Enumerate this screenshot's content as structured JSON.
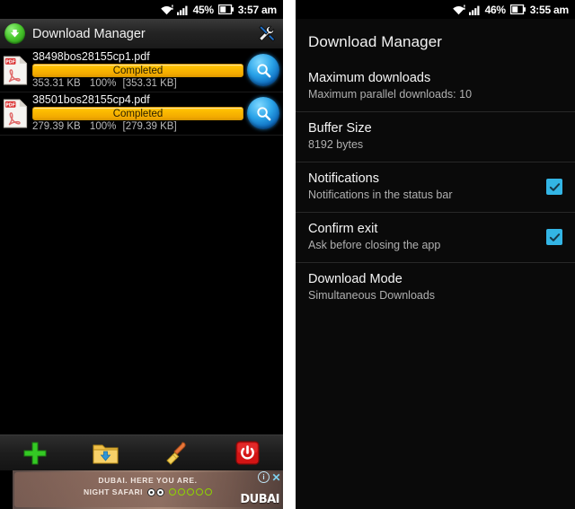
{
  "left_phone": {
    "status_bar": {
      "wifi_icon": "wifi-icon",
      "signal_icon": "cellular-signal-icon",
      "battery_percent": "45%",
      "battery_icon": "battery-icon",
      "time": "3:57 am"
    },
    "title_bar": {
      "app_icon": "download-arrow-icon",
      "title": "Download Manager",
      "tools_icon": "wrench-screwdriver-icon"
    },
    "downloads": [
      {
        "file_icon": "pdf-file-icon",
        "filename": "38498bos28155cp1.pdf",
        "status": "Completed",
        "size": "353.31 KB",
        "percent": "100%",
        "total": "[353.31 KB]",
        "action_icon": "search-magnifier-icon"
      },
      {
        "file_icon": "pdf-file-icon",
        "filename": "38501bos28155cp4.pdf",
        "status": "Completed",
        "size": "279.39 KB",
        "percent": "100%",
        "total": "[279.39 KB]",
        "action_icon": "search-magnifier-icon"
      }
    ],
    "toolbar": [
      {
        "icon": "add-plus-icon",
        "name": "add-download-button"
      },
      {
        "icon": "folder-download-icon",
        "name": "downloads-folder-button"
      },
      {
        "icon": "broom-clear-icon",
        "name": "clear-list-button"
      },
      {
        "icon": "power-off-icon",
        "name": "exit-button"
      }
    ],
    "ad": {
      "line1": "DUBAI. HERE YOU ARE.",
      "line2": "NIGHT SAFARI",
      "rating_dots": 5,
      "owl_icon": "tripadvisor-owl-icon",
      "logo": "DUBAI",
      "info_icon": "ad-info-icon",
      "close_icon": "ad-close-icon"
    }
  },
  "right_phone": {
    "status_bar": {
      "wifi_icon": "wifi-icon",
      "signal_icon": "cellular-signal-icon",
      "battery_percent": "46%",
      "battery_icon": "battery-icon",
      "time": "3:55 am"
    },
    "screen_title": "Download Manager",
    "preferences": [
      {
        "title": "Maximum downloads",
        "summary": "Maximum parallel downloads: 10",
        "has_checkbox": false,
        "checked": false
      },
      {
        "title": "Buffer Size",
        "summary": "8192 bytes",
        "has_checkbox": false,
        "checked": false
      },
      {
        "title": "Notifications",
        "summary": "Notifications in the status bar",
        "has_checkbox": true,
        "checked": true
      },
      {
        "title": "Confirm exit",
        "summary": "Ask before closing the app",
        "has_checkbox": true,
        "checked": true
      },
      {
        "title": "Download Mode",
        "summary": "Simultaneous Downloads",
        "has_checkbox": false,
        "checked": false
      }
    ]
  },
  "colors": {
    "accent_blue": "#33b5e5",
    "progress_gold": "#ffc000",
    "app_green": "#4cc92f",
    "power_red": "#cc1111",
    "background": "#000000"
  }
}
